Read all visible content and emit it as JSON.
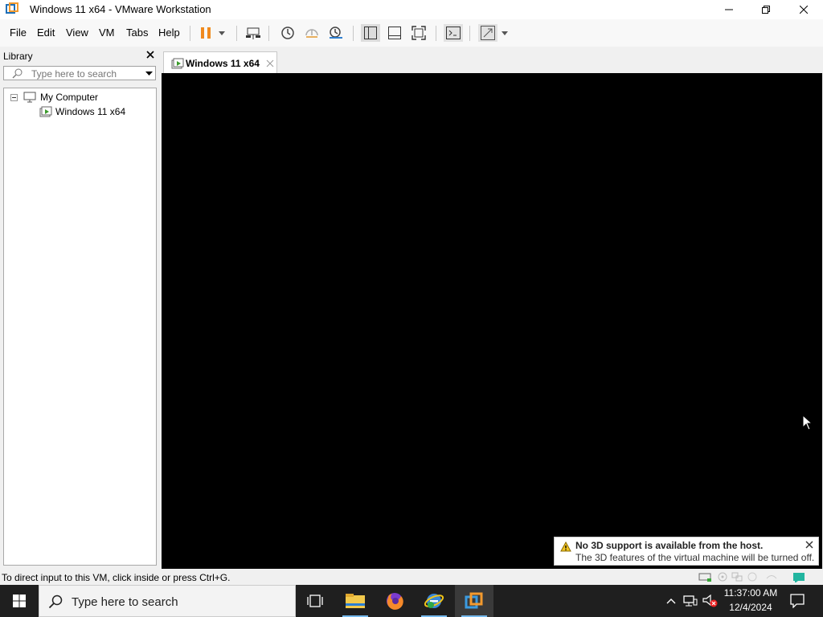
{
  "window": {
    "title": "Windows 11 x64 - VMware Workstation"
  },
  "menu": [
    "File",
    "Edit",
    "View",
    "VM",
    "Tabs",
    "Help"
  ],
  "library": {
    "title": "Library",
    "search_placeholder": "Type here to search",
    "tree": [
      {
        "label": "My Computer"
      },
      {
        "label": "Windows 11 x64"
      }
    ]
  },
  "tab": {
    "label": "Windows 11 x64"
  },
  "notification": {
    "title": "No 3D support is available from the host.",
    "body": "The 3D features of the virtual machine will be turned off."
  },
  "status": {
    "text": "To direct input to this VM, click inside or press Ctrl+G."
  },
  "taskbar": {
    "search_text": "Type here to search",
    "time": "11:37:00 AM",
    "date": "12/4/2024",
    "apps": [
      "task-view-icon",
      "file-explorer-icon",
      "firefox-icon",
      "ie-icon",
      "vmware-icon"
    ]
  },
  "colors": {
    "pause_accent": "#f08a1e",
    "taskbar_bg": "#1f1f1f",
    "warning": "#f3c623"
  }
}
